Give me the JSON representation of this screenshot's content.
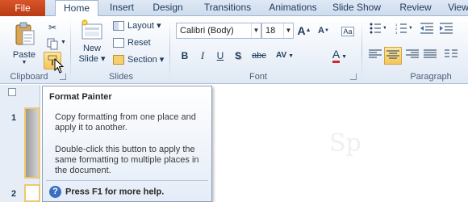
{
  "tabs": {
    "file": "File",
    "home": "Home",
    "insert": "Insert",
    "design": "Design",
    "transitions": "Transitions",
    "animations": "Animations",
    "slideshow": "Slide Show",
    "review": "Review",
    "view": "View"
  },
  "clipboard": {
    "paste": "Paste",
    "group": "Clipboard"
  },
  "slides": {
    "new_slide_line1": "New",
    "new_slide_line2": "Slide ▾",
    "layout": "Layout ▾",
    "reset": "Reset",
    "section": "Section ▾",
    "group": "Slides"
  },
  "font": {
    "family": "Calibri (Body)",
    "size": "18",
    "bold": "B",
    "italic": "I",
    "underline": "U",
    "shadow": "S",
    "strike": "abc",
    "spacing": "AV",
    "aa": "Aa",
    "grow": "A",
    "shrink": "A",
    "font_color": "A",
    "group": "Font"
  },
  "paragraph": {
    "group": "Paragraph"
  },
  "slides_pane": {
    "slide1": "1",
    "slide2": "2"
  },
  "canvas": {
    "watermark": "Sp"
  },
  "tooltip": {
    "title": "Format Painter",
    "p1": "Copy formatting from one place and apply it to another.",
    "p2": "Double-click this button to apply the same formatting to multiple places in the document.",
    "help": "Press F1 for more help."
  },
  "colors": {
    "file_tab": "#c6441b",
    "accent": "#1e395b",
    "highlight": "#f5d88a"
  }
}
